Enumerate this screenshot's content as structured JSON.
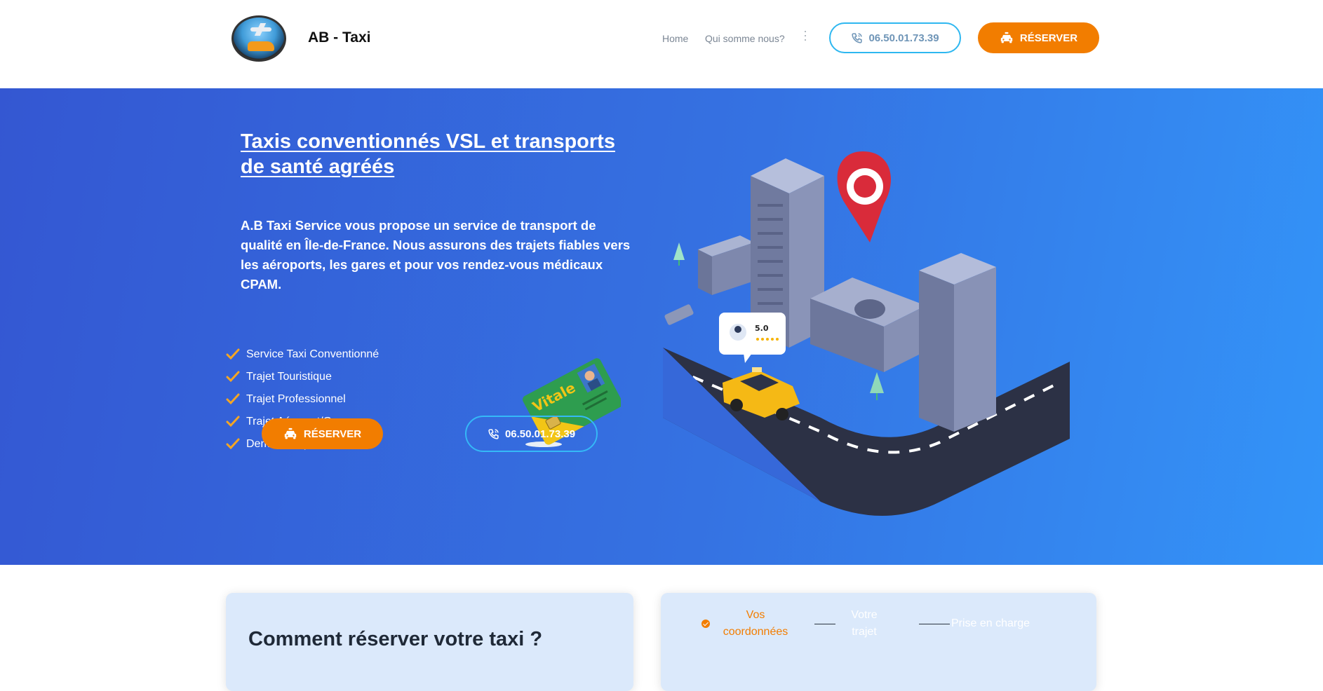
{
  "header": {
    "brand": "AB - Taxi",
    "nav": [
      "Home",
      "Qui somme nous?"
    ],
    "phone": "06.50.01.73.39",
    "reserve": "RÉSERVER"
  },
  "hero": {
    "title": "Taxis conventionnés VSL et transports de santé agréés",
    "description": "A.B Taxi Service vous propose un service de transport de qualité en Île-de-France. Nous assurons des trajets fiables vers les aéroports, les gares et pour vos rendez-vous médicaux CPAM.",
    "features": [
      "Service Taxi Conventionné",
      "Trajet Touristique",
      "Trajet Professionnel",
      "Trajet Aéroport/Gare",
      "Demande spéciale"
    ],
    "reserve": "RÉSERVER",
    "phone": "06.50.01.73.39",
    "card_label": "Vitale",
    "rating": "5.0"
  },
  "booking": {
    "heading": "Comment réserver votre taxi ?",
    "steps": [
      "Vos coordonnées",
      "Votre trajet",
      "Prise en charge"
    ]
  },
  "colors": {
    "accent": "#f27d00",
    "hero_start": "#3457d2",
    "hero_end": "#3394f8",
    "phone_border": "#2eb7f0"
  }
}
